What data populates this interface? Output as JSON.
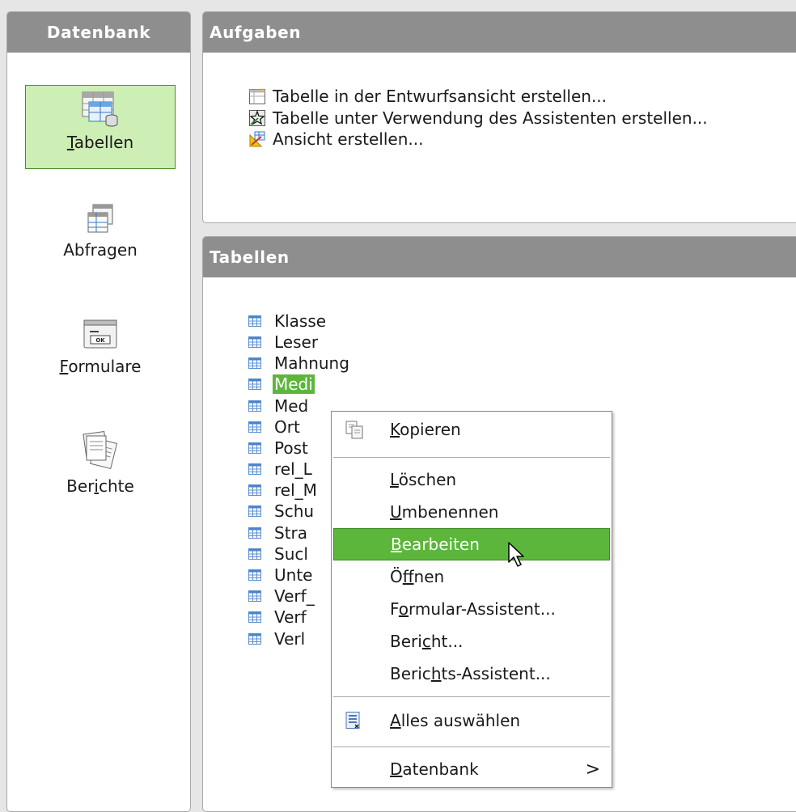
{
  "database_pane": {
    "header": "Datenbank",
    "items": [
      {
        "key": "tables",
        "pre": "",
        "mnemonic": "T",
        "post": "abellen",
        "active": true,
        "icon": "tables-icon"
      },
      {
        "key": "queries",
        "pre": "Abfra",
        "mnemonic": "g",
        "post": "en",
        "active": false,
        "icon": "queries-icon"
      },
      {
        "key": "forms",
        "pre": "",
        "mnemonic": "F",
        "post": "ormulare",
        "active": false,
        "icon": "forms-icon"
      },
      {
        "key": "reports",
        "pre": "Ber",
        "mnemonic": "i",
        "post": "chte",
        "active": false,
        "icon": "reports-icon"
      }
    ]
  },
  "tasks_panel": {
    "header": "Aufgaben",
    "tasks": [
      {
        "label": "Tabelle in der Entwurfsansicht erstellen...",
        "icon": "table-design-icon"
      },
      {
        "label": "Tabelle unter Verwendung des Assistenten erstellen...",
        "icon": "table-wizard-icon"
      },
      {
        "label": "Ansicht erstellen...",
        "icon": "create-view-icon"
      }
    ]
  },
  "tables_panel": {
    "header": "Tabellen",
    "tables": [
      "Klasse",
      "Leser",
      "Mahnung",
      "Medien",
      "Med",
      "Ort",
      "Post",
      "rel_L",
      "rel_M",
      "Schu",
      "Stra",
      "Sucl",
      "Unte",
      "Verf_",
      "Verf",
      "Verl"
    ],
    "selected_index": 3,
    "selected_visible": "Medi"
  },
  "context_menu": {
    "items": [
      {
        "pre": "",
        "mnemonic": "K",
        "post": "opieren",
        "icon": "copy-icon"
      },
      {
        "pre": "",
        "mnemonic": "L",
        "post": "öschen"
      },
      {
        "pre": "",
        "mnemonic": "U",
        "post": "mbenennen"
      },
      {
        "pre": "",
        "mnemonic": "B",
        "post": "earbeiten",
        "highlighted": true
      },
      {
        "pre": "Ö",
        "mnemonic": "f",
        "post": "fnen"
      },
      {
        "pre": "F",
        "mnemonic": "o",
        "post": "rmular-Assistent..."
      },
      {
        "pre": "Beri",
        "mnemonic": "c",
        "post": "ht..."
      },
      {
        "pre": "Beric",
        "mnemonic": "h",
        "post": "ts-Assistent..."
      },
      {
        "pre": "",
        "mnemonic": "A",
        "post": "lles auswählen",
        "icon": "select-all-icon"
      },
      {
        "pre": "",
        "mnemonic": "D",
        "post": "atenbank",
        "submenu": true
      }
    ],
    "submenu_arrow": ">"
  },
  "colors": {
    "header_bg": "#8e8e8e",
    "selection": "#5cb63c",
    "active_item_bg": "#cdeeb4"
  }
}
